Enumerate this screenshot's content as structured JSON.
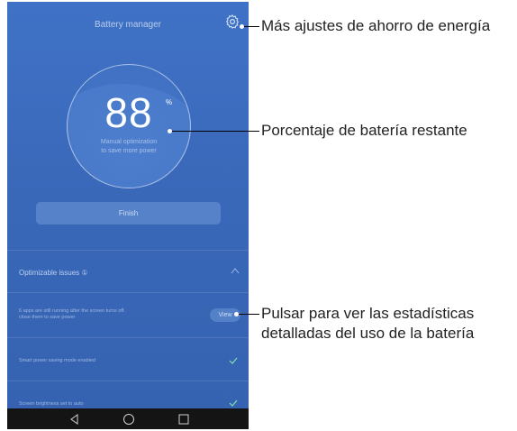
{
  "screen": {
    "title": "Battery manager",
    "battery_percent": "88",
    "percent_sign": "%",
    "optimization_line1": "Manual optimization",
    "optimization_line2": "to save more power",
    "finish_label": "Finish",
    "issues_title": "Optimizable issues ①",
    "issue1_line1": "6 apps are still running after the screen turns off.",
    "issue1_line2": "close them to save power",
    "view_label": "View",
    "issue2": "Smart power saving mode enabled",
    "issue3": "Screen brightness set to auto"
  },
  "callouts": {
    "settings": "Más ajustes de ahorro de energía",
    "percent": "Porcentaje de batería restante",
    "view_line1": "Pulsar para ver las estadísticas",
    "view_line2": "detalladas del uso de la batería"
  },
  "icons": [
    "gear-icon",
    "chevron-up-icon",
    "check-icon",
    "back-nav-icon",
    "home-nav-icon",
    "recents-nav-icon"
  ],
  "colors": {
    "background": "#3a68b9",
    "accent_check": "#7fe0b0",
    "navbar": "#141414"
  }
}
